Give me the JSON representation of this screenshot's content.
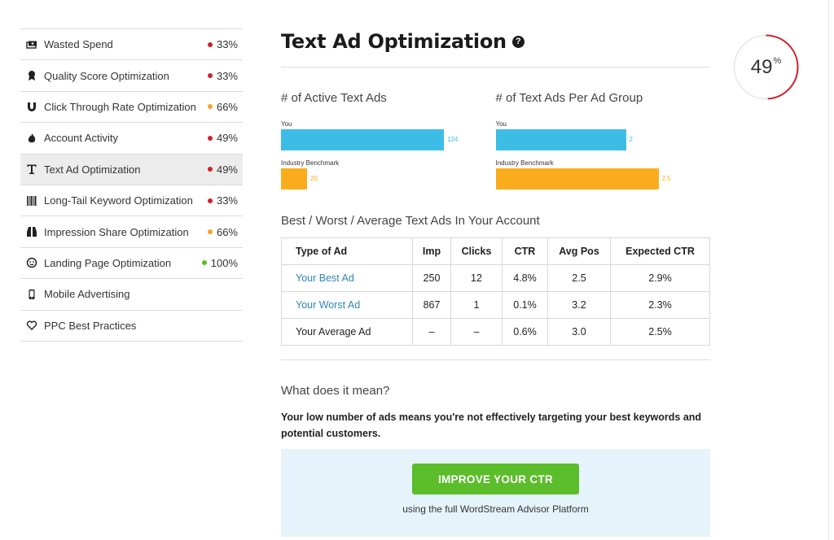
{
  "sidebar": {
    "items": [
      {
        "label": "Wasted Spend",
        "score": "33%",
        "dot_color": "#d0202a",
        "icon": "money-icon"
      },
      {
        "label": "Quality Score Optimization",
        "score": "33%",
        "dot_color": "#d0202a",
        "icon": "ribbon-icon"
      },
      {
        "label": "Click Through Rate Optimization",
        "score": "66%",
        "dot_color": "#f5a623",
        "icon": "magnet-icon"
      },
      {
        "label": "Account Activity",
        "score": "49%",
        "dot_color": "#d0202a",
        "icon": "flame-icon"
      },
      {
        "label": "Text Ad Optimization",
        "score": "49%",
        "dot_color": "#d0202a",
        "icon": "text-icon",
        "active": true
      },
      {
        "label": "Long-Tail Keyword Optimization",
        "score": "33%",
        "dot_color": "#d0202a",
        "icon": "barcode-icon"
      },
      {
        "label": "Impression Share Optimization",
        "score": "66%",
        "dot_color": "#f5a623",
        "icon": "binoculars-icon"
      },
      {
        "label": "Landing Page Optimization",
        "score": "100%",
        "dot_color": "#5bbd2a",
        "icon": "smiley-icon"
      },
      {
        "label": "Mobile Advertising",
        "score": "",
        "dot_color": "",
        "icon": "phone-icon"
      },
      {
        "label": "PPC Best Practices",
        "score": "",
        "dot_color": "",
        "icon": "heart-icon"
      }
    ]
  },
  "main": {
    "title": "Text Ad Optimization",
    "help_icon": "?",
    "section_title": "Best / Worst / Average Text Ads In Your Account",
    "table": {
      "headers": [
        "Type of Ad",
        "Imp",
        "Clicks",
        "CTR",
        "Avg Pos",
        "Expected CTR"
      ],
      "rows": [
        [
          "Your Best Ad",
          "250",
          "12",
          "4.8%",
          "2.5",
          "2.9%"
        ],
        [
          "Your Worst Ad",
          "867",
          "1",
          "0.1%",
          "3.2",
          "2.3%"
        ],
        [
          "Your Average Ad",
          "–",
          "–",
          "0.6%",
          "3.0",
          "2.5%"
        ]
      ]
    },
    "meaning_title": "What does it mean?",
    "meaning_text": "Your low number of ads means you're not effectively targeting your best keywords and potential customers.",
    "cta_button": "IMPROVE YOUR CTR",
    "cta_subtext": "using the full WordStream Advisor Platform"
  },
  "score": {
    "value": "49",
    "unit": "%",
    "fraction": 0.49,
    "ring_color": "#d0202a"
  },
  "chart_data": [
    {
      "type": "bar",
      "title": "# of Active Text Ads",
      "categories": [
        "You",
        "Industry Benchmark"
      ],
      "values": [
        124,
        20
      ],
      "value_labels": [
        "124",
        "20"
      ],
      "colors": [
        "#3dbde6",
        "#fbac1c"
      ]
    },
    {
      "type": "bar",
      "title": "# of Text Ads Per Ad Group",
      "categories": [
        "You",
        "Industry Benchmark"
      ],
      "values": [
        2,
        2.5
      ],
      "value_labels": [
        "2",
        "2.5"
      ],
      "colors": [
        "#3dbde6",
        "#fbac1c"
      ]
    }
  ]
}
